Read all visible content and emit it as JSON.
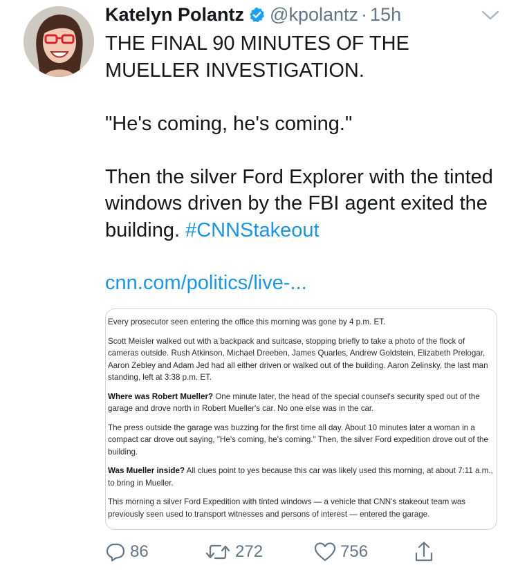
{
  "tweet": {
    "author": {
      "name": "Katelyn Polantz",
      "handle": "@kpolantz",
      "avatar_icon": "avatar-photo"
    },
    "time": "15h",
    "time_separator": "·",
    "text": {
      "line1": "THE FINAL 90 MINUTES OF THE MUELLER INVESTIGATION.",
      "line2": "\"He's coming, he's coming.\"",
      "line3": "Then the silver Ford Explorer with the tinted windows driven by the FBI agent exited the building.",
      "hashtag": "#CNNStakeout"
    },
    "link": "cnn.com/politics/live-...",
    "card": {
      "p1": "Every prosecutor seen entering the office this morning was gone by 4 p.m. ET.",
      "p2": "Scott Meisler walked out with a backpack and suitcase, stopping briefly to take a photo of the flock of cameras outside. Rush Atkinson, Michael Dreeben, James Quarles, Andrew Goldstein, Elizabeth Prelogar, Aaron Zebley and Adam Jed had all either driven or walked out of the building. Aaron Zelinsky, the last man standing, left at 3:38 p.m. ET.",
      "p3_bold": "Where was Robert Mueller?",
      "p3": " One minute later, the head of the special counsel's security sped out of the garage and drove north in Robert Mueller's car. No one else was in the car.",
      "p4": "The press outside the garage was buzzing for the first time all day. About 10 minutes later a woman in a compact car drove out saying, \"He's coming, he's coming.\" Then, the silver Ford expedition drove out of the building.",
      "p5_bold": "Was Mueller inside?",
      "p5": " All clues point to yes because this car was likely used this morning, at about 7:11 a.m., to bring in Mueller.",
      "p6": "This morning a silver Ford Expedition with tinted windows — a vehicle that CNN's stakeout team was previously seen used to transport witnesses and persons of interest — entered the garage."
    },
    "actions": {
      "reply_count": "86",
      "retweet_count": "272",
      "like_count": "756"
    },
    "colors": {
      "link": "#1b95e0",
      "secondary": "#657786",
      "verified": "#1da1f2"
    }
  }
}
